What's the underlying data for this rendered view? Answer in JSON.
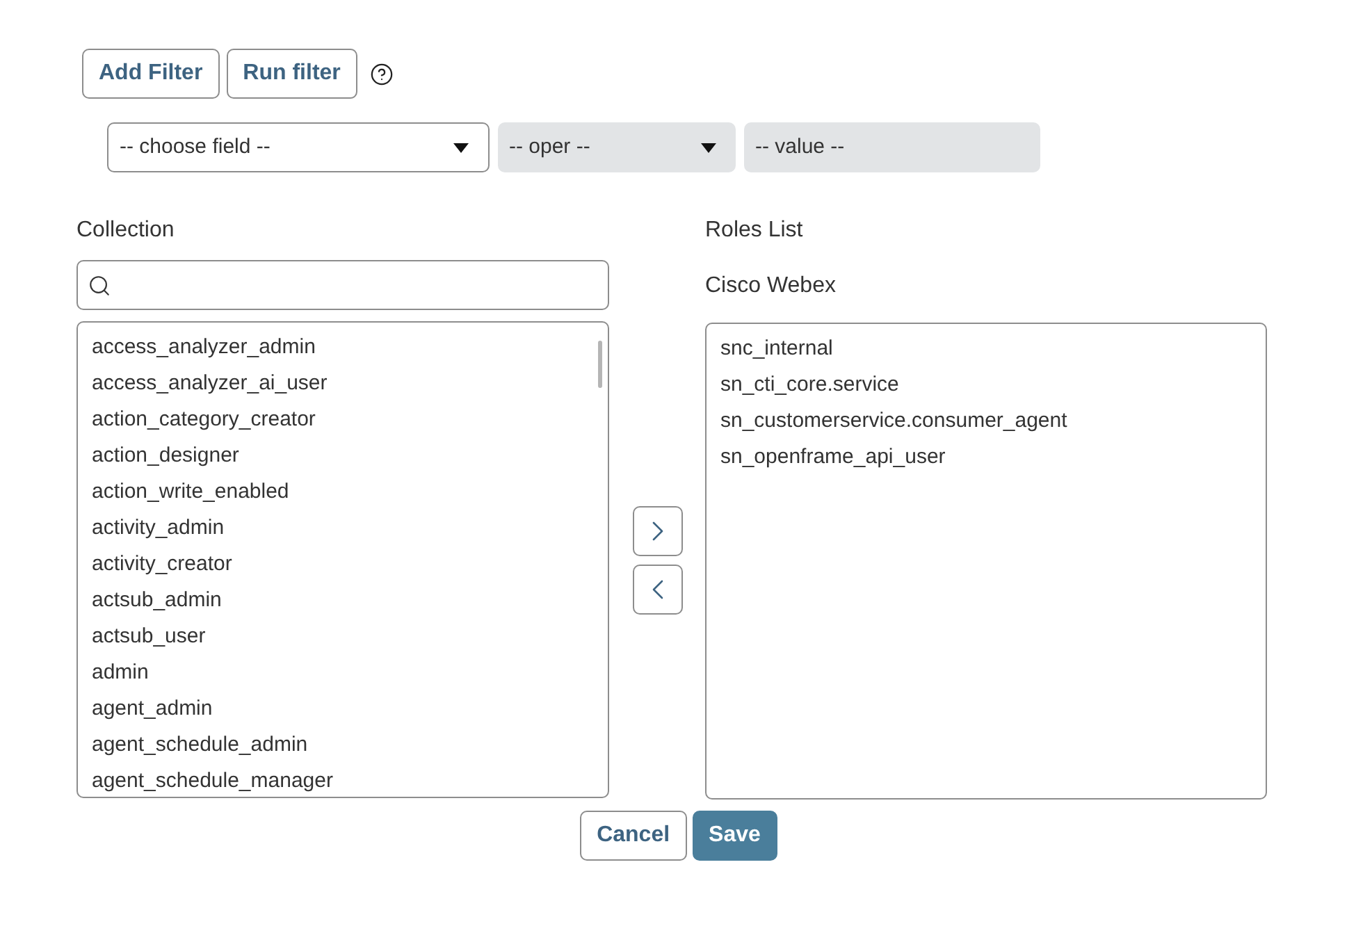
{
  "toolbar": {
    "buttons": [
      {
        "label": "Add Filter"
      },
      {
        "label": "Run filter"
      }
    ]
  },
  "filter": [
    {
      "kind": "select",
      "value": "-- choose field --",
      "disabled": false
    },
    {
      "kind": "select",
      "value": "-- oper --",
      "disabled": true
    },
    {
      "kind": "text",
      "value": "-- value --",
      "disabled": true
    }
  ],
  "collection": {
    "label": "Collection",
    "items": [
      {
        "label": "access_analyzer_admin",
        "selected": false
      },
      {
        "label": "access_analyzer_ai_user",
        "selected": false
      },
      {
        "label": "action_category_creator",
        "selected": false
      },
      {
        "label": "action_designer",
        "selected": false
      },
      {
        "label": "action_write_enabled",
        "selected": false
      },
      {
        "label": "activity_admin",
        "selected": false
      },
      {
        "label": "activity_creator",
        "selected": false
      },
      {
        "label": "actsub_admin",
        "selected": false
      },
      {
        "label": "actsub_user",
        "selected": false
      },
      {
        "label": "admin",
        "selected": false
      },
      {
        "label": "agent_admin",
        "selected": false
      },
      {
        "label": "agent_schedule_admin",
        "selected": false
      },
      {
        "label": "agent_schedule_manager",
        "selected": false
      }
    ]
  },
  "move_buttons": [
    {
      "kind": "add"
    },
    {
      "kind": "remove"
    }
  ],
  "roles": {
    "label": "Roles List",
    "group": "Cisco Webex",
    "items": [
      {
        "label": "snc_internal",
        "selected": false
      },
      {
        "label": "sn_cti_core.service",
        "selected": false
      },
      {
        "label": "sn_customerservice.consumer_agent",
        "selected": false
      },
      {
        "label": "sn_openframe_api_user",
        "selected": false
      }
    ]
  },
  "actions": [
    {
      "label": "Cancel",
      "kind": "secondary"
    },
    {
      "label": "Save",
      "kind": "primary"
    }
  ]
}
